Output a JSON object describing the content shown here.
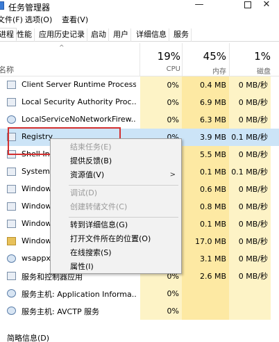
{
  "window": {
    "title": "任务管理器",
    "minimize_glyph": "—",
    "close_glyph": "✕"
  },
  "menu": [
    "文件(F)",
    "选项(O)",
    "查看(V)"
  ],
  "tabs": [
    "进程",
    "性能",
    "应用历史记录",
    "启动",
    "用户",
    "详细信息",
    "服务"
  ],
  "active_tab": "进程",
  "header": {
    "sort_glyph": "^",
    "name_label": "名称",
    "cpu_pct": "19%",
    "cpu_label": "CPU",
    "mem_pct": "45%",
    "mem_label": "内存",
    "disk_pct": "1%",
    "disk_label": "磁盘"
  },
  "rows": [
    {
      "name": "Client Server Runtime Process",
      "cpu": "0%",
      "mem": "0.4 MB",
      "disk": "0 MB/秒",
      "icon": "window-icon"
    },
    {
      "name": "Local Security Authority Proc...",
      "cpu": "0%",
      "mem": "6.9 MB",
      "disk": "0 MB/秒",
      "icon": "window-icon"
    },
    {
      "name": "LocalServiceNoNetworkFirew...",
      "cpu": "0%",
      "mem": "6.3 MB",
      "disk": "0 MB/秒",
      "icon": "gear-icon"
    },
    {
      "name": "Registry",
      "cpu": "0%",
      "mem": "3.9 MB",
      "disk": "0.1 MB/秒",
      "icon": "window-icon"
    },
    {
      "name": "Shell In",
      "cpu": "",
      "mem": "5.5 MB",
      "disk": "0 MB/秒",
      "icon": "window-icon"
    },
    {
      "name": "System",
      "cpu": "",
      "mem": "0.1 MB",
      "disk": "0.1 MB/秒",
      "icon": "window-icon"
    },
    {
      "name": "Window",
      "cpu": "",
      "mem": "0.6 MB",
      "disk": "0 MB/秒",
      "icon": "window-icon"
    },
    {
      "name": "Window",
      "cpu": "",
      "mem": "0.8 MB",
      "disk": "0 MB/秒",
      "icon": "window-icon"
    },
    {
      "name": "Window",
      "cpu": "",
      "mem": "0.1 MB",
      "disk": "0 MB/秒",
      "icon": "window-icon"
    },
    {
      "name": "Window",
      "cpu": "",
      "mem": "17.0 MB",
      "disk": "0 MB/秒",
      "icon": "folder-icon"
    },
    {
      "name": "wsappx",
      "cpu": "",
      "mem": "3.1 MB",
      "disk": "0 MB/秒",
      "icon": "gear-icon"
    },
    {
      "name": "服务和控制器应用",
      "cpu": "0%",
      "mem": "2.6 MB",
      "disk": "0 MB/秒",
      "icon": "window-icon"
    },
    {
      "name": "服务主机: Application Informa...",
      "cpu": "0%",
      "mem": "",
      "disk": "",
      "icon": "gear-icon"
    },
    {
      "name": "服务主机: AVCTP 服务",
      "cpu": "0%",
      "mem": "",
      "disk": "",
      "icon": "gear-icon"
    }
  ],
  "context_menu": {
    "items": [
      {
        "label": "结束任务(E)",
        "disabled": true
      },
      {
        "label": "提供反馈(B)",
        "disabled": false
      },
      {
        "label": "资源值(V)",
        "disabled": false,
        "submenu": true
      },
      {
        "label": "调试(D)",
        "disabled": true
      },
      {
        "label": "创建转储文件(C)",
        "disabled": true
      },
      {
        "label": "转到详细信息(G)",
        "disabled": false
      },
      {
        "label": "打开文件所在的位置(O)",
        "disabled": false
      },
      {
        "label": "在线搜索(S)",
        "disabled": false
      },
      {
        "label": "属性(I)",
        "disabled": false
      }
    ],
    "submenu_glyph": ">"
  },
  "footer": {
    "label": "简略信息(D)"
  }
}
